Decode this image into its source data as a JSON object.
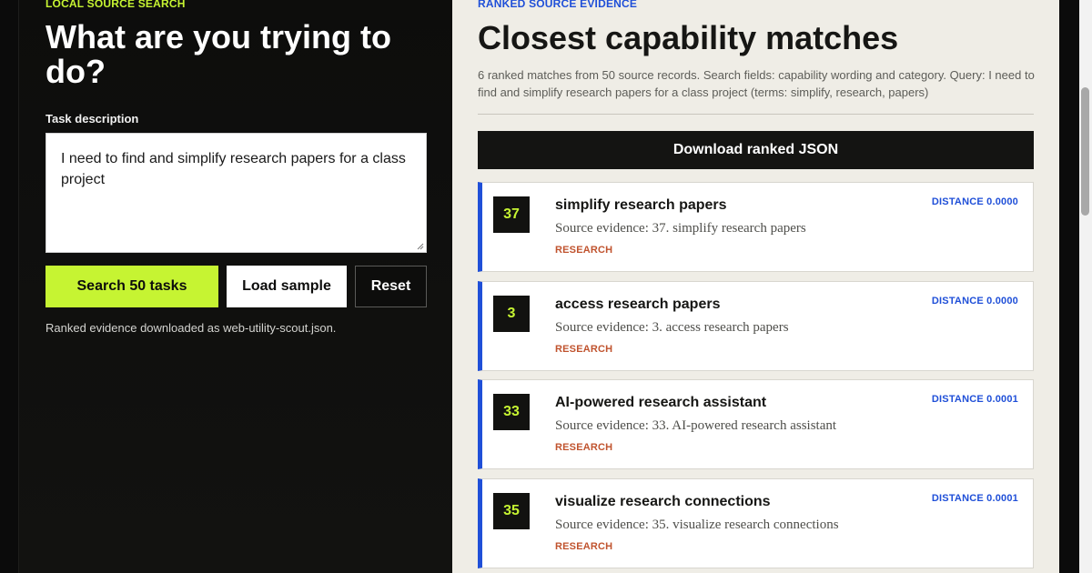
{
  "search_panel": {
    "eyebrow": "LOCAL SOURCE SEARCH",
    "heading": "What are you trying to do?",
    "task_label": "Task description",
    "task_value": "I need to find and simplify research papers for a class project",
    "search_button": "Search 50 tasks",
    "sample_button": "Load sample",
    "reset_button": "Reset",
    "status": "Ranked evidence downloaded as web-utility-scout.json."
  },
  "results_panel": {
    "eyebrow": "RANKED SOURCE EVIDENCE",
    "heading": "Closest capability matches",
    "summary": "6 ranked matches from 50 source records. Search fields: capability wording and category. Query: I need to find and simplify research papers for a class project (terms: simplify, research, papers)",
    "download_button": "Download ranked JSON",
    "results": [
      {
        "rank": "37",
        "title": "simplify research papers",
        "source": "Source evidence: 37. simplify research papers",
        "category": "RESEARCH",
        "distance": "DISTANCE 0.0000"
      },
      {
        "rank": "3",
        "title": "access research papers",
        "source": "Source evidence: 3. access research papers",
        "category": "RESEARCH",
        "distance": "DISTANCE 0.0000"
      },
      {
        "rank": "33",
        "title": "AI-powered research assistant",
        "source": "Source evidence: 33. AI-powered research assistant",
        "category": "RESEARCH",
        "distance": "DISTANCE 0.0001"
      },
      {
        "rank": "35",
        "title": "visualize research connections",
        "source": "Source evidence: 35. visualize research connections",
        "category": "RESEARCH",
        "distance": "DISTANCE 0.0001"
      }
    ]
  },
  "colors": {
    "accent_lime": "#c6f432",
    "accent_blue": "#1f4fd8",
    "category_orange": "#c0532e",
    "dark_panel": "#0d0d0c",
    "light_panel": "#efede6"
  },
  "icons": [
    "resize-grip-icon"
  ]
}
